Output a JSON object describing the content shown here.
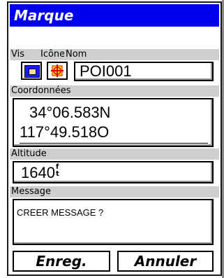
{
  "dialog": {
    "title": "Marque",
    "labels": {
      "vis": "Vis",
      "icone": "Icône",
      "nom": "Nom",
      "coordonnees": "Coordonnées",
      "altitude": "Altitude",
      "message": "Message"
    },
    "name_value": "POI001",
    "coords": {
      "lat": "34°06.583N",
      "lon": "117°49.518O"
    },
    "altitude": {
      "value": "1640",
      "unit": "ft"
    },
    "message_value": "CREER MESSAGE ?",
    "buttons": {
      "save": "Enreg.",
      "cancel": "Annuler"
    }
  },
  "colors": {
    "title_bg": "#0000ee",
    "label_band": "#cfcfcf",
    "vis_icon": "#1a1aff",
    "poi_icon": "#e00000"
  }
}
